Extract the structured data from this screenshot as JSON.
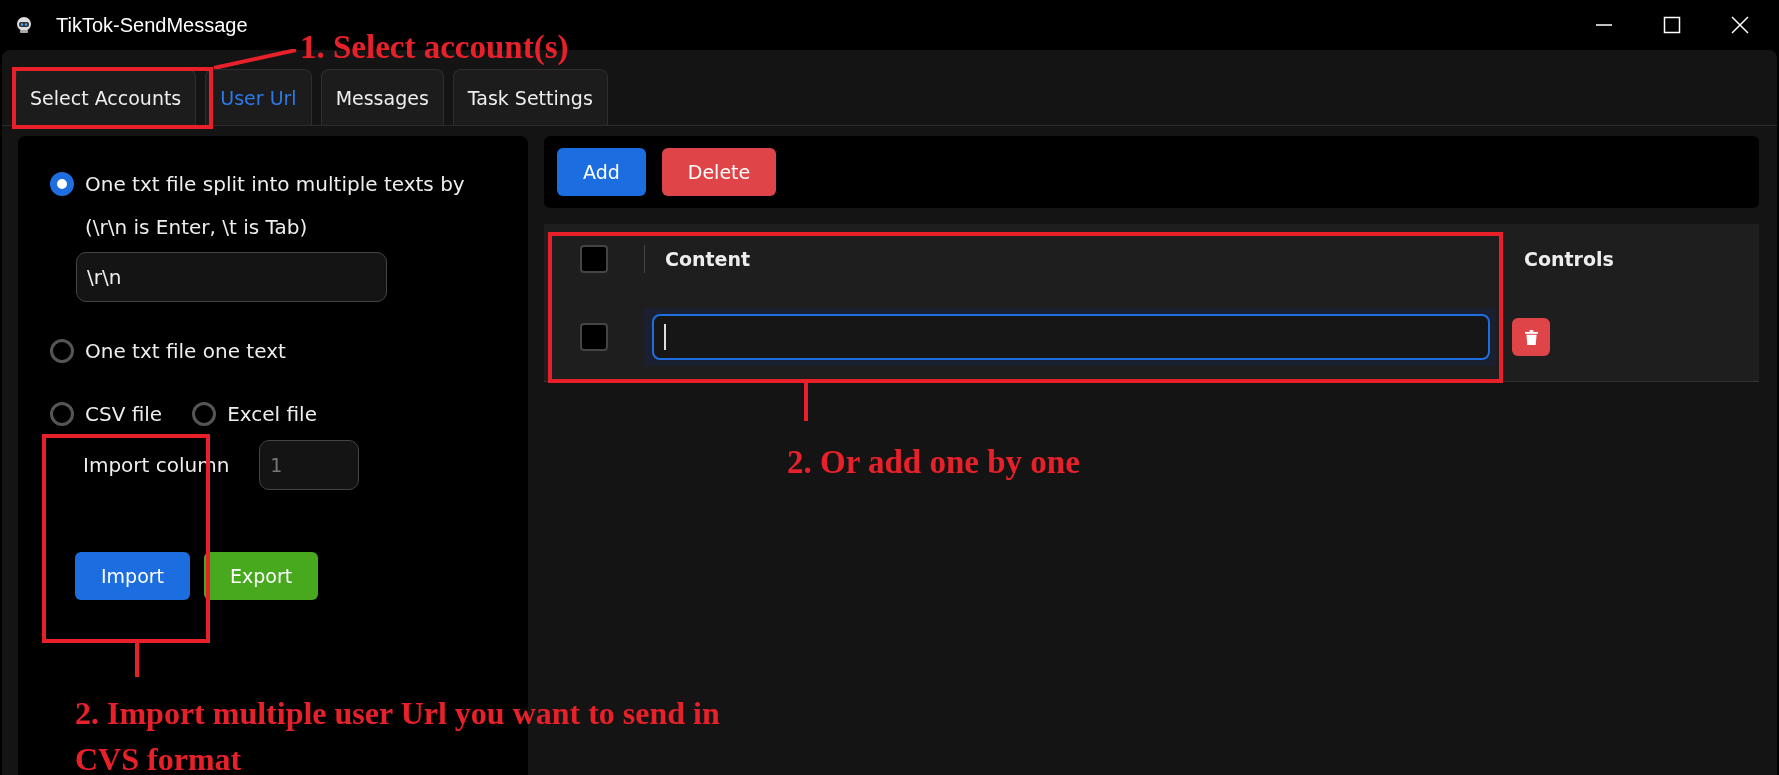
{
  "window": {
    "title": "TikTok-SendMessage"
  },
  "tabs": [
    {
      "label": "Select Accounts",
      "selected": false
    },
    {
      "label": "User Url",
      "selected": true
    },
    {
      "label": "Messages",
      "selected": false
    },
    {
      "label": "Task Settings",
      "selected": false
    }
  ],
  "import_panel": {
    "split_option": {
      "label": "One txt file split into multiple texts by",
      "hint": "(\\r\\n is Enter, \\t is Tab)",
      "selected": true,
      "separator": "\\r\\n"
    },
    "single_option": {
      "label": "One txt file one text",
      "selected": false
    },
    "file_options": [
      {
        "label": "CSV file",
        "selected": false
      },
      {
        "label": "Excel file",
        "selected": false
      }
    ],
    "import_column": {
      "label": "Import column",
      "placeholder": "1"
    },
    "buttons": [
      {
        "label": "Import",
        "kind": "primary"
      },
      {
        "label": "Export",
        "kind": "success"
      }
    ]
  },
  "toolbar": {
    "buttons": [
      {
        "label": "Add",
        "kind": "primary"
      },
      {
        "label": "Delete",
        "kind": "danger"
      }
    ]
  },
  "table": {
    "header_checked": false,
    "columns": [
      "Content",
      "Controls"
    ],
    "rows": [
      {
        "checked": false,
        "focused": true
      }
    ]
  },
  "annotations": [
    {
      "text": "1. Select account(s)"
    },
    {
      "text": "2.  Import multiple user Url you want to send in CVS format"
    },
    {
      "text": "2. Or add one by one"
    }
  ]
}
